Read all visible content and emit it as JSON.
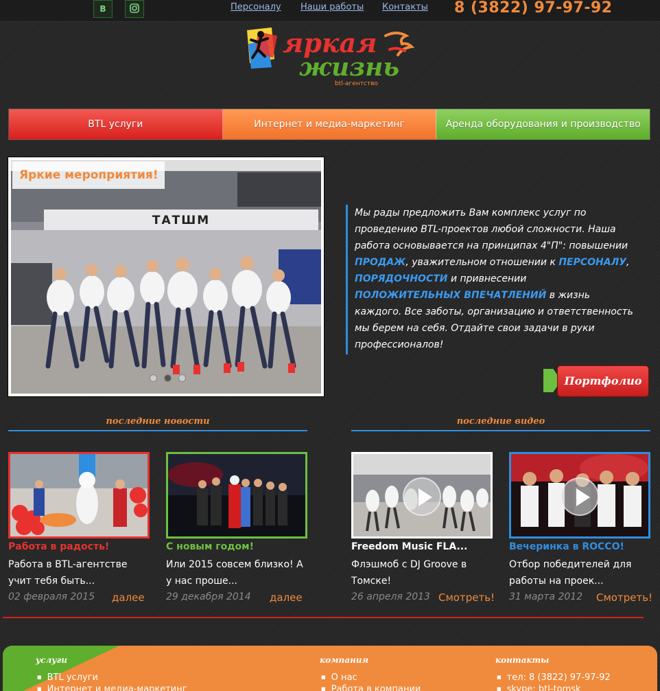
{
  "topbar": {
    "social": [
      {
        "label": "В",
        "icon": "vk-icon"
      },
      {
        "label": "",
        "icon": "instagram-icon"
      }
    ],
    "links": [
      "Персоналу",
      "Наши работы",
      "Контакты"
    ],
    "phone": "8 (3822) 97-97-92"
  },
  "logo": {
    "line1": "яркая",
    "line2": "жизнь",
    "sub": "btl-агентство"
  },
  "tabs": [
    "BTL услуги",
    "Интернет и медиа-маркетинг",
    "Аренда оборудования и производство"
  ],
  "slider": {
    "tag": "Яркие мероприятия!",
    "store_sign": "ТАТШМ",
    "dots": 3,
    "active_dot": 1
  },
  "about": {
    "t1": "Мы рады предложить Вам комплекс услуг по проведению BTL-проектов любой сложности. Наша работа основывается на принципах 4\"П\": повышении ",
    "h1": "ПРОДАЖ",
    "t2": ", уважительном отношении к ",
    "h2": "ПЕРСОНАЛУ",
    "t3": ", ",
    "h3": "ПОРЯДОЧНОСТИ",
    "t4": " и привнесении ",
    "h4": "ПОЛОЖИТЕЛЬНЫХ ВПЕЧАТЛЕНИЙ",
    "t5": " в жизнь каждого. Все заботы, организацию и ответственность мы берем на себя. Отдайте свои задачи в руки профессионалов!"
  },
  "portfolio_button": "Портфолио",
  "sections": {
    "news": "последние новости",
    "videos": "последние видео"
  },
  "news": [
    {
      "title": "Работа в радость!",
      "text": "Работа в BTL-агентстве учит тебя быть...",
      "date": "02 февраля 2015",
      "more": "далее",
      "color": "#e8322f"
    },
    {
      "title": "С новым годом!",
      "text": "Или 2015 совсем близко! А у нас проше...",
      "date": "29 декабря 2014",
      "more": "далее",
      "color": "#6cc040"
    }
  ],
  "videos": [
    {
      "title": "Freedom Music FLA...",
      "text": "Флэшмоб с DJ Groove в Томске!",
      "date": "26 апреля 2013",
      "more": "Смотреть!",
      "color": "#ffffff"
    },
    {
      "title": "Вечеринка в ROCCO!",
      "text": "Отбор победителей для работы на проек...",
      "date": "31 марта 2012",
      "more": "Смотреть!",
      "color": "#2f8ee0"
    }
  ],
  "footer": {
    "services": {
      "title": "услуги",
      "items": [
        "BTL услуги",
        "Интернет и медиа-маркетинг"
      ]
    },
    "company": {
      "title": "компания",
      "items": [
        "О нас",
        "Работа в компании"
      ]
    },
    "contacts": {
      "title": "контакты",
      "items": [
        "тел: 8 (3822) 97-97-92",
        "skype: btl-tomsk"
      ]
    }
  }
}
